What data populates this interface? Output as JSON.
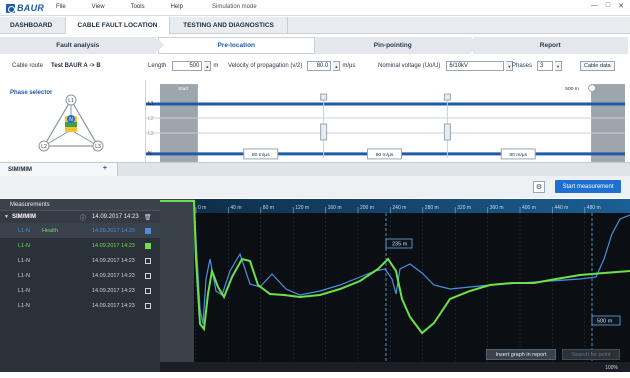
{
  "titlebar": {
    "logo_text": "BAUR",
    "menu": [
      "File",
      "View",
      "Tools",
      "Help"
    ],
    "mode": "Simulation mode"
  },
  "main_tabs": [
    "DASHBOARD",
    "CABLE FAULT LOCATION",
    "TESTING AND DIAGNOSTICS"
  ],
  "steps": [
    "Fault analysis",
    "Pre-location",
    "Pin-pointing",
    "Report"
  ],
  "params": {
    "cable_route_label": "Cable route",
    "cable_route_value": "Test BAUR A -> B",
    "length_label": "Length",
    "length_value": "500",
    "length_unit": "m",
    "vop_label": "Velocity of propagation (v/2)",
    "vop_value": "80.0",
    "vop_unit": "m/μs",
    "voltage_label": "Nominal voltage (Uo/U)",
    "voltage_value": "6/10kV",
    "phases_label": "Phases",
    "phases_value": "3",
    "cable_data_button": "Cable data"
  },
  "phase_selector": {
    "title": "Phase selector",
    "phase_nodes": [
      "L1",
      "L2",
      "L3",
      "N"
    ],
    "lines": [
      "L1",
      "L2",
      "L3",
      "N"
    ],
    "start_label": "Start",
    "end_label": "500 m",
    "speed_labels": [
      "80 m/μs",
      "80 m/μs",
      "80 m/μs"
    ]
  },
  "sim_tab": {
    "label": "SIM/MIM",
    "plus": "+"
  },
  "toolbar": {
    "start_button": "Start measurement"
  },
  "measurements": {
    "header": "Measurements",
    "group": {
      "name": "SIM/MIM",
      "time": "14.09.2017 14:23"
    },
    "rows": [
      {
        "name": "L1-N",
        "health": "Health",
        "time": "14.09.2017 14:23",
        "color": "#4a8fe0",
        "checked": true
      },
      {
        "name": "L1-N",
        "health": "",
        "time": "14.09.2017 14:23",
        "color": "#6de04a",
        "checked": true
      },
      {
        "name": "L1-N",
        "health": "",
        "time": "14.09.2017 14:23",
        "color": "#cfd6dd",
        "checked": false
      },
      {
        "name": "L1-N",
        "health": "",
        "time": "14.09.2017 14:23",
        "color": "#cfd6dd",
        "checked": false
      },
      {
        "name": "L1-N",
        "health": "",
        "time": "14.09.2017 14:23",
        "color": "#cfd6dd",
        "checked": false
      },
      {
        "name": "L1-N",
        "health": "",
        "time": "14.09.2017 14:23",
        "color": "#cfd6dd",
        "checked": false
      }
    ]
  },
  "graph": {
    "x_ticks": [
      "0 m",
      "40 m",
      "80 m",
      "120 m",
      "160 m",
      "200 m",
      "240 m",
      "280 m",
      "320 m",
      "360 m",
      "400 m",
      "440 m",
      "480 m"
    ],
    "cursor1_label": "235 m",
    "cursor2_label": "500 m",
    "insert_button": "Insert graph in report",
    "search_button": "Search for point",
    "zoom": "100%"
  },
  "colors": {
    "accent": "#1e6fd0",
    "trace_blue": "#4a8fe0",
    "trace_green": "#6de04a",
    "graph_bg": "#0b0f14"
  }
}
